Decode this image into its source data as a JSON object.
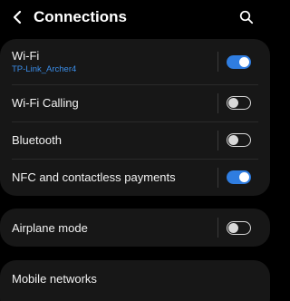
{
  "header": {
    "title": "Connections",
    "back_icon": "chevron-left-icon",
    "search_icon": "search-icon"
  },
  "colors": {
    "background": "#000000",
    "card": "#171717",
    "accent": "#2f7de1",
    "subtitle": "#3b8eea"
  },
  "group1": {
    "wifi": {
      "label": "Wi-Fi",
      "network": "TP-Link_Archer4",
      "enabled": true
    },
    "wifi_calling": {
      "label": "Wi-Fi Calling",
      "enabled": false
    },
    "bluetooth": {
      "label": "Bluetooth",
      "enabled": false
    },
    "nfc": {
      "label": "NFC and contactless payments",
      "enabled": true
    }
  },
  "group2": {
    "airplane": {
      "label": "Airplane mode",
      "enabled": false
    }
  },
  "group3": {
    "mobile": {
      "label": "Mobile networks"
    }
  }
}
